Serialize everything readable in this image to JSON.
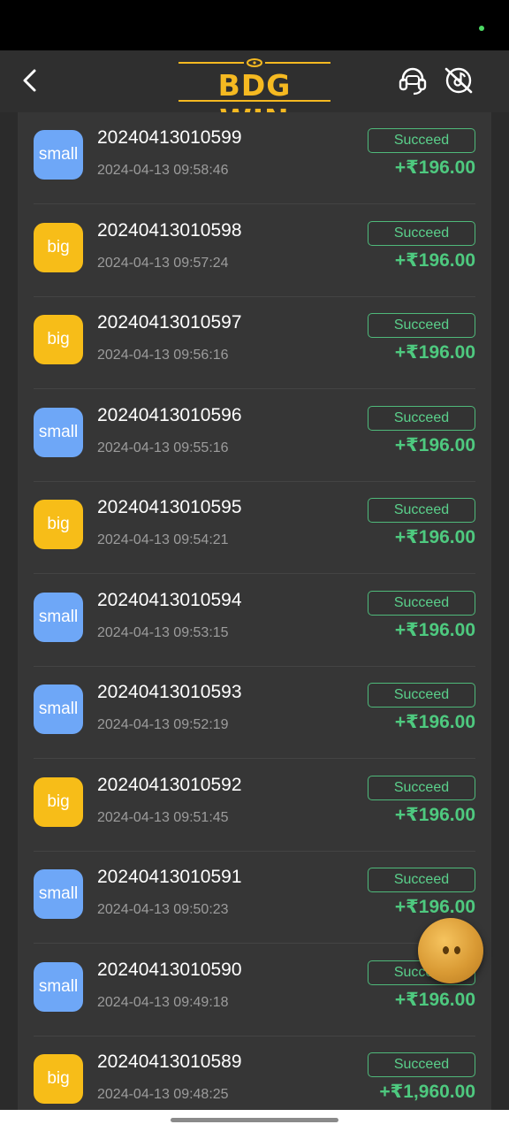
{
  "header": {
    "logo_text": "BDG WIN",
    "back_icon": "chevron-left-icon",
    "support_icon": "headset-icon",
    "sound_icon": "music-off-icon"
  },
  "colors": {
    "small": "#6ea7f7",
    "big": "#f7bd18",
    "success": "#4ec97f",
    "logo": "#f5b921"
  },
  "orders": [
    {
      "type": "small",
      "id": "20240413010599",
      "time": "2024-04-13 09:58:46",
      "status": "Succeed",
      "amount": "+₹196.00"
    },
    {
      "type": "big",
      "id": "20240413010598",
      "time": "2024-04-13 09:57:24",
      "status": "Succeed",
      "amount": "+₹196.00"
    },
    {
      "type": "big",
      "id": "20240413010597",
      "time": "2024-04-13 09:56:16",
      "status": "Succeed",
      "amount": "+₹196.00"
    },
    {
      "type": "small",
      "id": "20240413010596",
      "time": "2024-04-13 09:55:16",
      "status": "Succeed",
      "amount": "+₹196.00"
    },
    {
      "type": "big",
      "id": "20240413010595",
      "time": "2024-04-13 09:54:21",
      "status": "Succeed",
      "amount": "+₹196.00"
    },
    {
      "type": "small",
      "id": "20240413010594",
      "time": "2024-04-13 09:53:15",
      "status": "Succeed",
      "amount": "+₹196.00"
    },
    {
      "type": "small",
      "id": "20240413010593",
      "time": "2024-04-13 09:52:19",
      "status": "Succeed",
      "amount": "+₹196.00"
    },
    {
      "type": "big",
      "id": "20240413010592",
      "time": "2024-04-13 09:51:45",
      "status": "Succeed",
      "amount": "+₹196.00"
    },
    {
      "type": "small",
      "id": "20240413010591",
      "time": "2024-04-13 09:50:23",
      "status": "Succeed",
      "amount": "+₹196.00"
    },
    {
      "type": "small",
      "id": "20240413010590",
      "time": "2024-04-13 09:49:18",
      "status": "Succeed",
      "amount": "+₹196.00"
    },
    {
      "type": "big",
      "id": "20240413010589",
      "time": "2024-04-13 09:48:25",
      "status": "Succeed",
      "amount": "+₹1,960.00"
    }
  ]
}
